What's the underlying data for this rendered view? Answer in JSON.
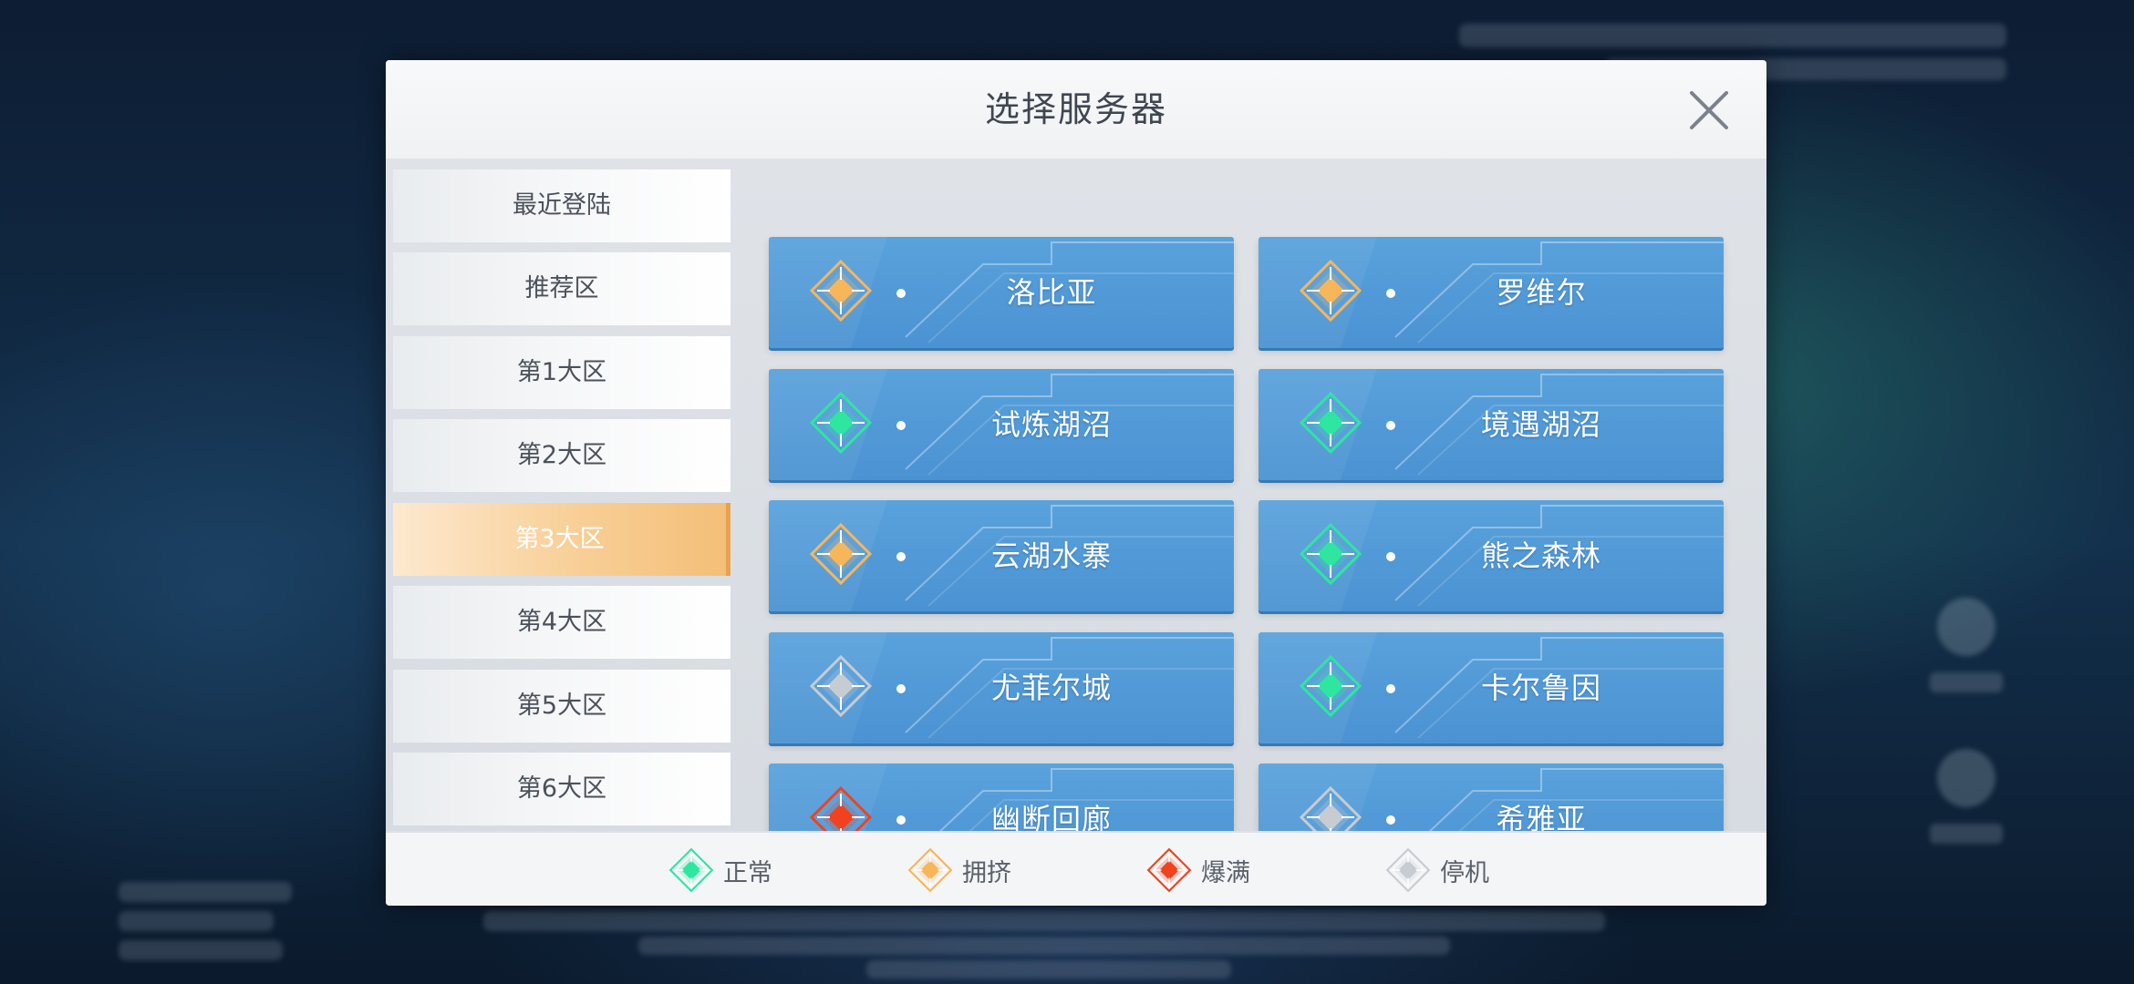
{
  "dialog": {
    "title": "选择服务器"
  },
  "sidebar": {
    "items": [
      {
        "label": "最近登陆",
        "active": false
      },
      {
        "label": "推荐区",
        "active": false
      },
      {
        "label": "第1大区",
        "active": false
      },
      {
        "label": "第2大区",
        "active": false
      },
      {
        "label": "第3大区",
        "active": true
      },
      {
        "label": "第4大区",
        "active": false
      },
      {
        "label": "第5大区",
        "active": false
      },
      {
        "label": "第6大区",
        "active": false
      }
    ]
  },
  "servers": [
    {
      "name": "洛比亚",
      "status": "crowded"
    },
    {
      "name": "罗维尔",
      "status": "crowded"
    },
    {
      "name": "试炼湖沼",
      "status": "normal"
    },
    {
      "name": "境遇湖沼",
      "status": "normal"
    },
    {
      "name": "云湖水寨",
      "status": "crowded"
    },
    {
      "name": "熊之森林",
      "status": "normal"
    },
    {
      "name": "尤菲尔城",
      "status": "offline"
    },
    {
      "name": "卡尔鲁因",
      "status": "normal"
    },
    {
      "name": "幽断回廊",
      "status": "full"
    },
    {
      "name": "希雅亚",
      "status": "offline"
    }
  ],
  "legend": [
    {
      "key": "normal",
      "label": "正常"
    },
    {
      "key": "crowded",
      "label": "拥挤"
    },
    {
      "key": "full",
      "label": "爆满"
    },
    {
      "key": "offline",
      "label": "停机"
    }
  ],
  "status_colors": {
    "normal": "#2ee6a0",
    "crowded": "#f7b65a",
    "full": "#f0421e",
    "offline": "#c7ccd2"
  },
  "icons": {
    "close": "close-icon",
    "status": "diamond-status-icon"
  }
}
